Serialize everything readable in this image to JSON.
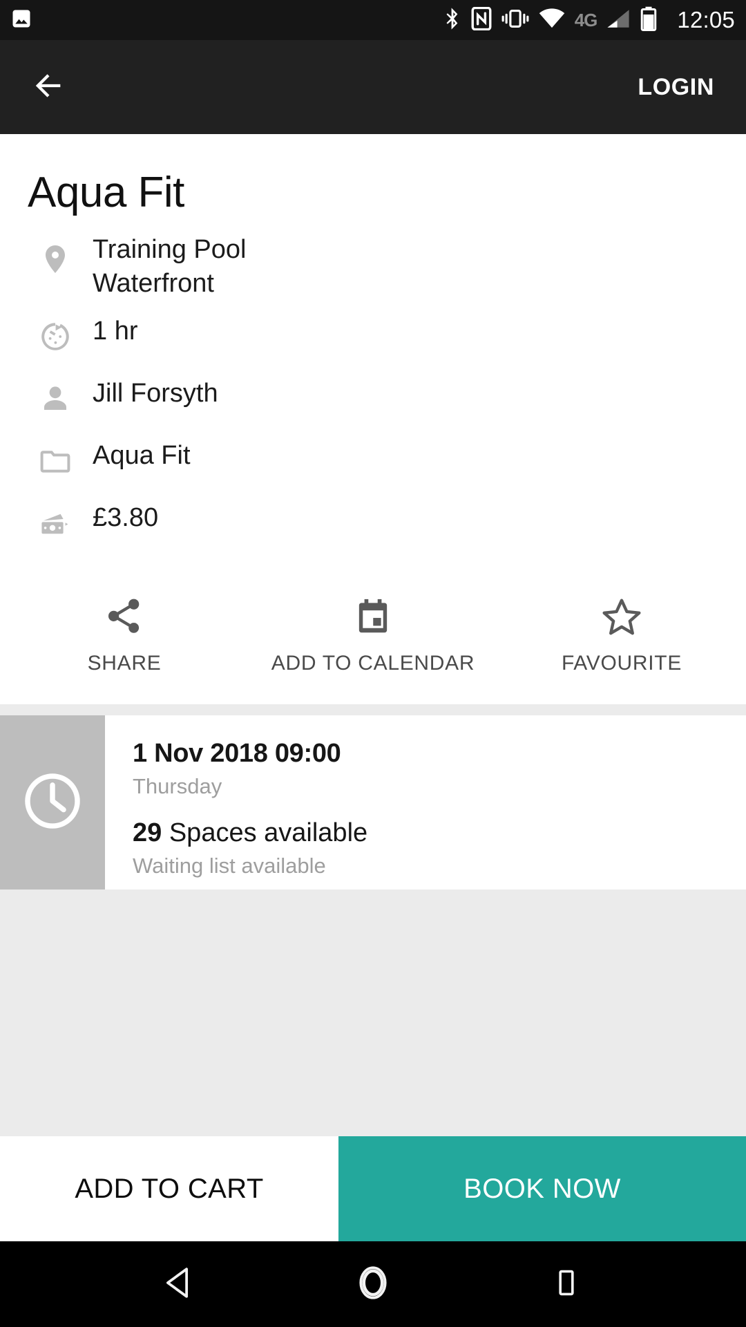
{
  "statusbar": {
    "notification_icon": "image-icon",
    "icons": [
      "bluetooth-icon",
      "nfc-icon",
      "vibrate-icon",
      "wifi-icon"
    ],
    "network_label": "4G",
    "signal_icon": "cellular-signal-icon",
    "battery_icon": "battery-icon",
    "time": "12:05"
  },
  "toolbar": {
    "back_icon": "arrow-left-icon",
    "login_label": "LOGIN"
  },
  "activity": {
    "title": "Aqua Fit",
    "details": [
      {
        "icon": "location-pin-icon",
        "text": "Training Pool\nWaterfront",
        "name": "location"
      },
      {
        "icon": "timer-icon",
        "text": "1 hr",
        "name": "duration"
      },
      {
        "icon": "person-icon",
        "text": "Jill Forsyth",
        "name": "instructor"
      },
      {
        "icon": "folder-icon",
        "text": "Aqua Fit",
        "name": "category"
      },
      {
        "icon": "money-icon",
        "text": "£3.80",
        "name": "price"
      }
    ]
  },
  "actions": [
    {
      "icon": "share-icon",
      "label": "SHARE"
    },
    {
      "icon": "calendar-icon",
      "label": "ADD TO CALENDAR"
    },
    {
      "icon": "star-icon",
      "label": "FAVOURITE"
    }
  ],
  "session": {
    "thumb_icon": "clock-icon",
    "date": "1 Nov 2018 09:00",
    "day": "Thursday",
    "spaces_count": "29",
    "spaces_label": " Spaces available",
    "waiting_list": "Waiting list available"
  },
  "bottom": {
    "add_to_cart_label": "ADD TO CART",
    "book_now_label": "BOOK NOW",
    "book_now_color": "#23a89c"
  },
  "navbar": {
    "back_icon": "nav-back-triangle-icon",
    "home_icon": "nav-home-circle-icon",
    "recents_icon": "nav-recents-square-icon"
  }
}
